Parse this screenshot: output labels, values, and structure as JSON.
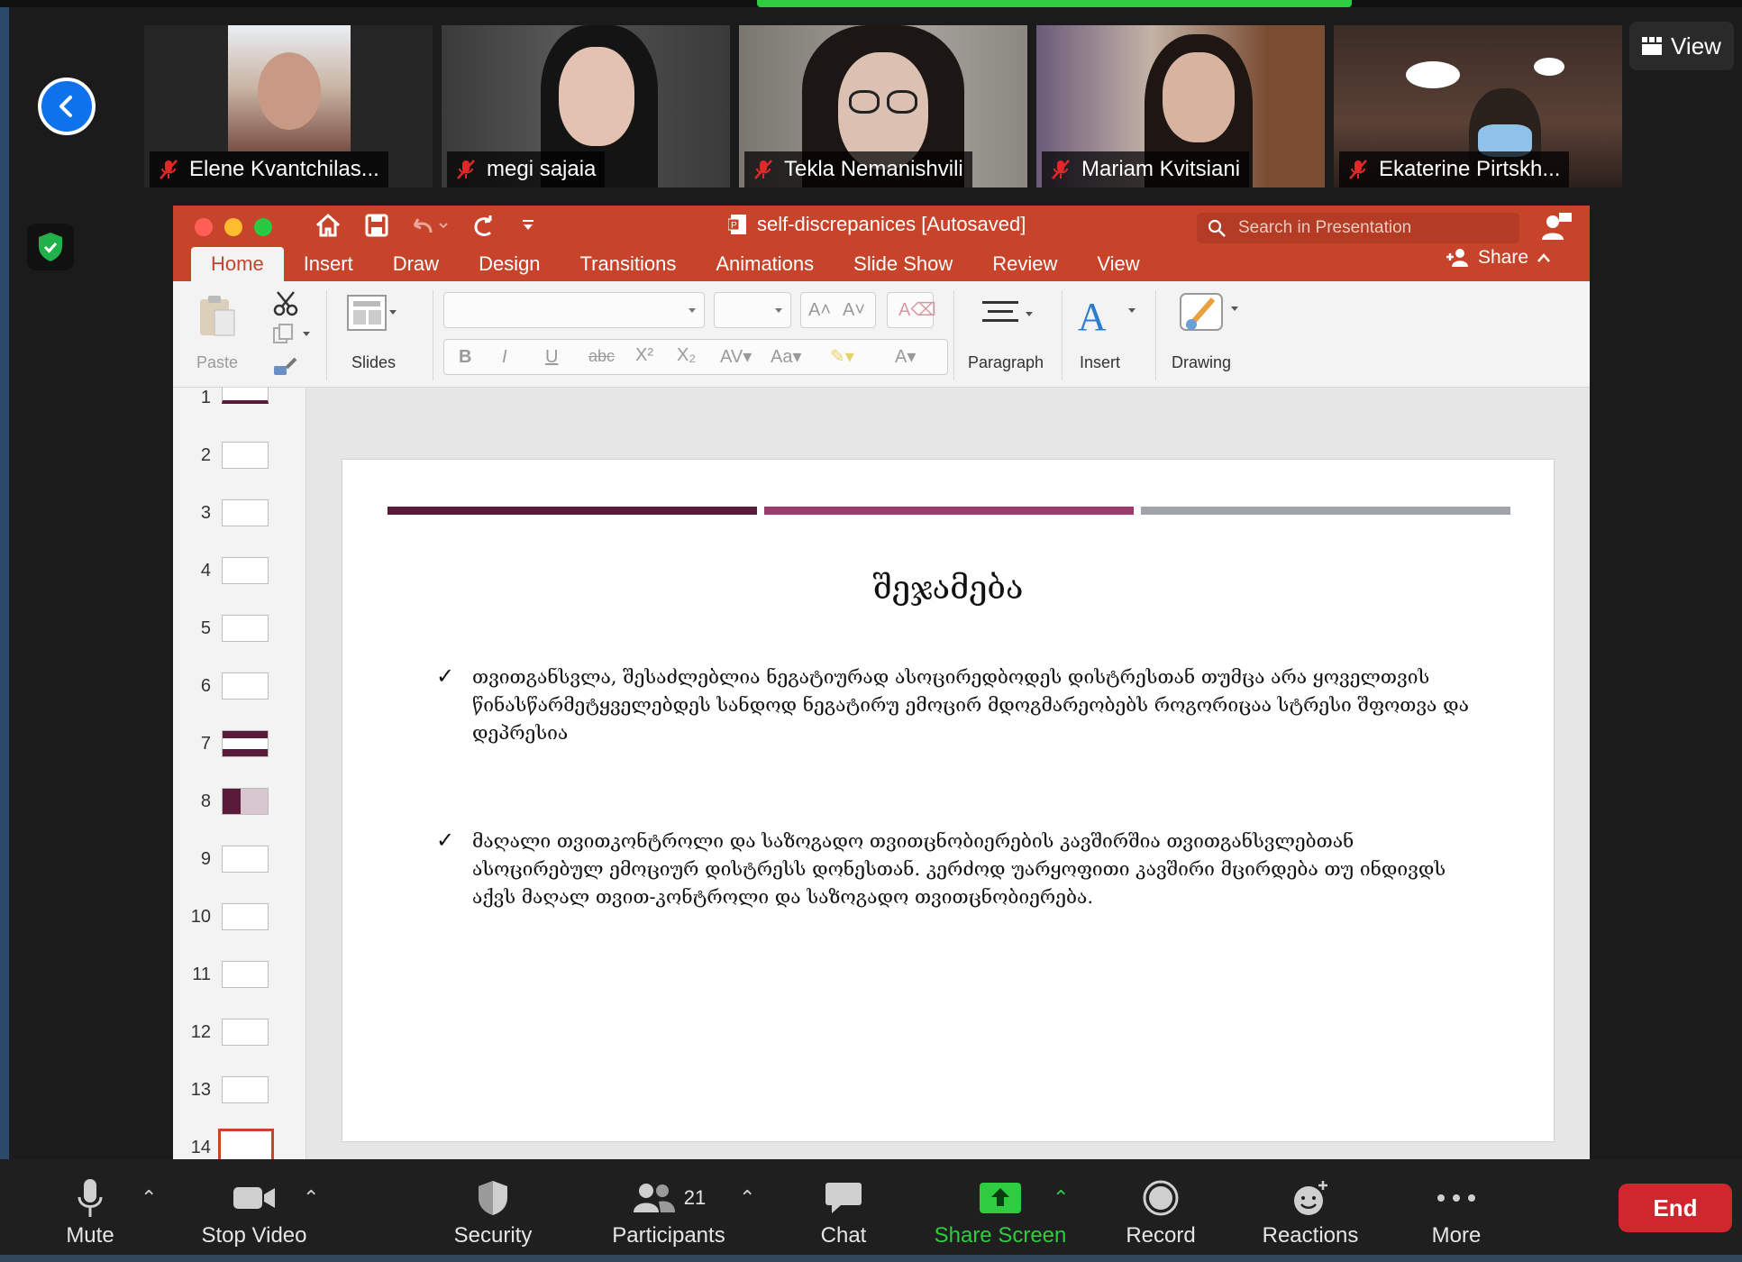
{
  "zoom": {
    "view_label": "View",
    "participants": [
      {
        "name": "Elene Kvantchilas..."
      },
      {
        "name": "megi sajaia"
      },
      {
        "name": "Tekla Nemanishvili"
      },
      {
        "name": "Mariam Kvitsiani"
      },
      {
        "name": "Ekaterine Pirtskh..."
      }
    ],
    "toolbar": {
      "mute": "Mute",
      "stop_video": "Stop Video",
      "security": "Security",
      "participants": "Participants",
      "participants_count": "21",
      "chat": "Chat",
      "share_screen": "Share Screen",
      "record": "Record",
      "reactions": "Reactions",
      "more": "More",
      "end": "End"
    },
    "colors": {
      "share_green": "#2ecc40",
      "end_red": "#d0262d",
      "accent_blue": "#0e72ed"
    }
  },
  "powerpoint": {
    "doc_title": "self-discrepanices [Autosaved]",
    "search_placeholder": "Search in Presentation",
    "tabs": [
      "Home",
      "Insert",
      "Draw",
      "Design",
      "Transitions",
      "Animations",
      "Slide Show",
      "Review",
      "View"
    ],
    "active_tab": "Home",
    "share_label": "Share",
    "ribbon": {
      "paste": "Paste",
      "slides": "Slides",
      "paragraph": "Paragraph",
      "insert": "Insert",
      "drawing": "Drawing"
    },
    "thumbnails": [
      "1",
      "2",
      "3",
      "4",
      "5",
      "6",
      "7",
      "8",
      "9",
      "10",
      "11",
      "12",
      "13",
      "14"
    ],
    "selected_slide": "14",
    "accent": "#c7432a",
    "slide": {
      "title": "შეჯამება",
      "bullets": [
        "თვითგანსვლა, შესაძლებლია ნეგატიურად ასოცირედბოდეს დისტრესთან    თუმცა არა ყოველთვის წინასწარმეტყველებდეს სანდოდ ნეგატირუ ემოცირ მდოგმარეობებს როგორიცაა სტრესი შფოთვა და დეპრესია",
        "მაღალი თვითკონტროლი და საზოგადო თვითცნობიერების კავშირშია თვითგანსვლებთან ასოცირებულ ემოციურ დისტრესს დონესთან. კერძოდ უარყოფითი კავშირი მცირდება თუ ინდივდს აქვს მაღალ თვით-კონტროლი და საზოგადო თვითცნობიერება."
      ],
      "bar_colors": [
        "#5a1a3a",
        "#9c3a6a",
        "#a0a4aa"
      ]
    }
  }
}
